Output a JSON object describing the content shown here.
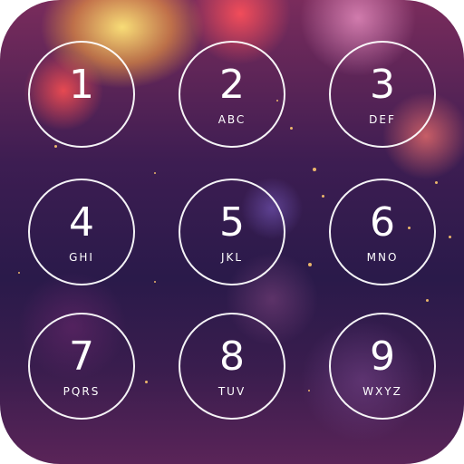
{
  "keypad": {
    "keys": [
      {
        "digit": "1",
        "letters": ""
      },
      {
        "digit": "2",
        "letters": "ABC"
      },
      {
        "digit": "3",
        "letters": "DEF"
      },
      {
        "digit": "4",
        "letters": "GHI"
      },
      {
        "digit": "5",
        "letters": "JKL"
      },
      {
        "digit": "6",
        "letters": "MNO"
      },
      {
        "digit": "7",
        "letters": "PQRS"
      },
      {
        "digit": "8",
        "letters": "TUV"
      },
      {
        "digit": "9",
        "letters": "WXYZ"
      }
    ]
  },
  "colors": {
    "key_outline": "#ffffff",
    "key_text": "#ffffff",
    "background_dark": "#2a1a4a",
    "bokeh_warm": "#ffd27a",
    "bokeh_red": "#ff5a6a"
  }
}
